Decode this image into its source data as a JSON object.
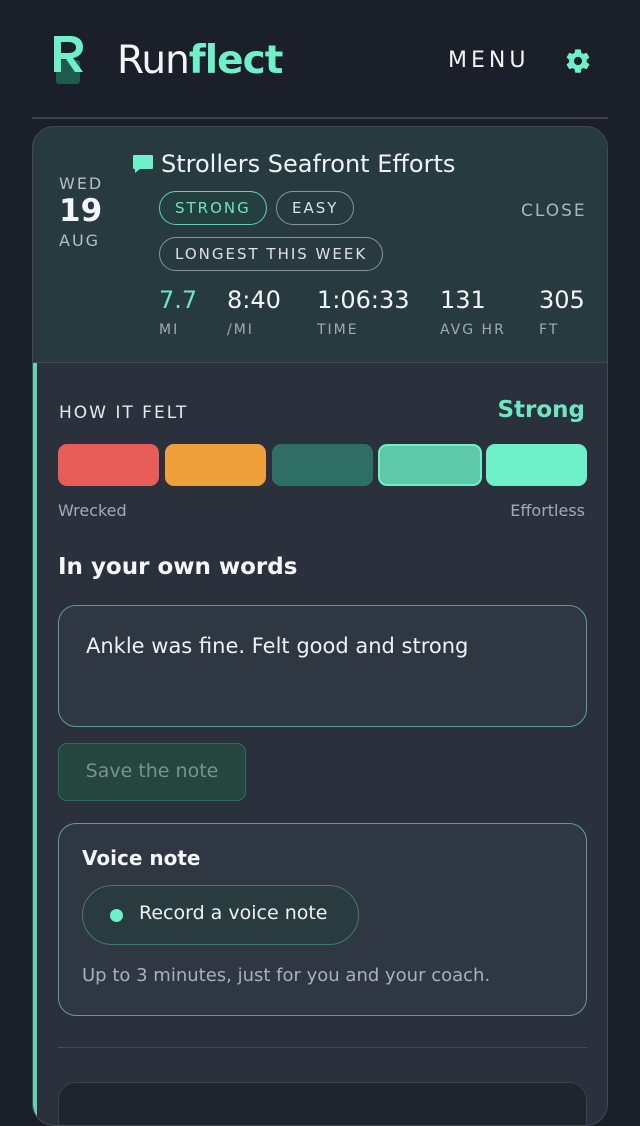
{
  "header": {
    "brand_part1": "Run",
    "brand_part2": "flect",
    "logo_letter": "R",
    "menu_label": "MENU",
    "settings_icon": "gear-icon"
  },
  "run": {
    "date": {
      "dow": "WED",
      "day": "19",
      "month": "AUG"
    },
    "title_icon": "comment-icon",
    "title": "Strollers Seafront Efforts",
    "tags": [
      "STRONG",
      "EASY",
      "LONGEST THIS WEEK"
    ],
    "close_label": "CLOSE",
    "stats": [
      {
        "value": "7.7",
        "label": "MI"
      },
      {
        "value": "8:40",
        "label": "/MI"
      },
      {
        "value": "1:06:33",
        "label": "TIME"
      },
      {
        "value": "131",
        "label": "AVG HR"
      },
      {
        "value": "305",
        "label": "FT"
      }
    ]
  },
  "felt": {
    "label": "HOW IT FELT",
    "value": "Strong",
    "scale_min": "Wrecked",
    "scale_max": "Effortless",
    "selected_index": 3,
    "colors": [
      "#e85d57",
      "#f0a03a",
      "#2f6f63",
      "#5ec9a9",
      "#6ef0c8"
    ]
  },
  "notes": {
    "title": "In your own words",
    "text": "Ankle was fine. Felt good and strong",
    "save_label": "Save the note"
  },
  "voice": {
    "title": "Voice note",
    "record_label": "Record a voice note",
    "hint": "Up to 3 minutes, just for you and your coach."
  },
  "colors": {
    "accent": "#6ef0c8",
    "background": "#1b1f29",
    "card": "#2b313c"
  }
}
